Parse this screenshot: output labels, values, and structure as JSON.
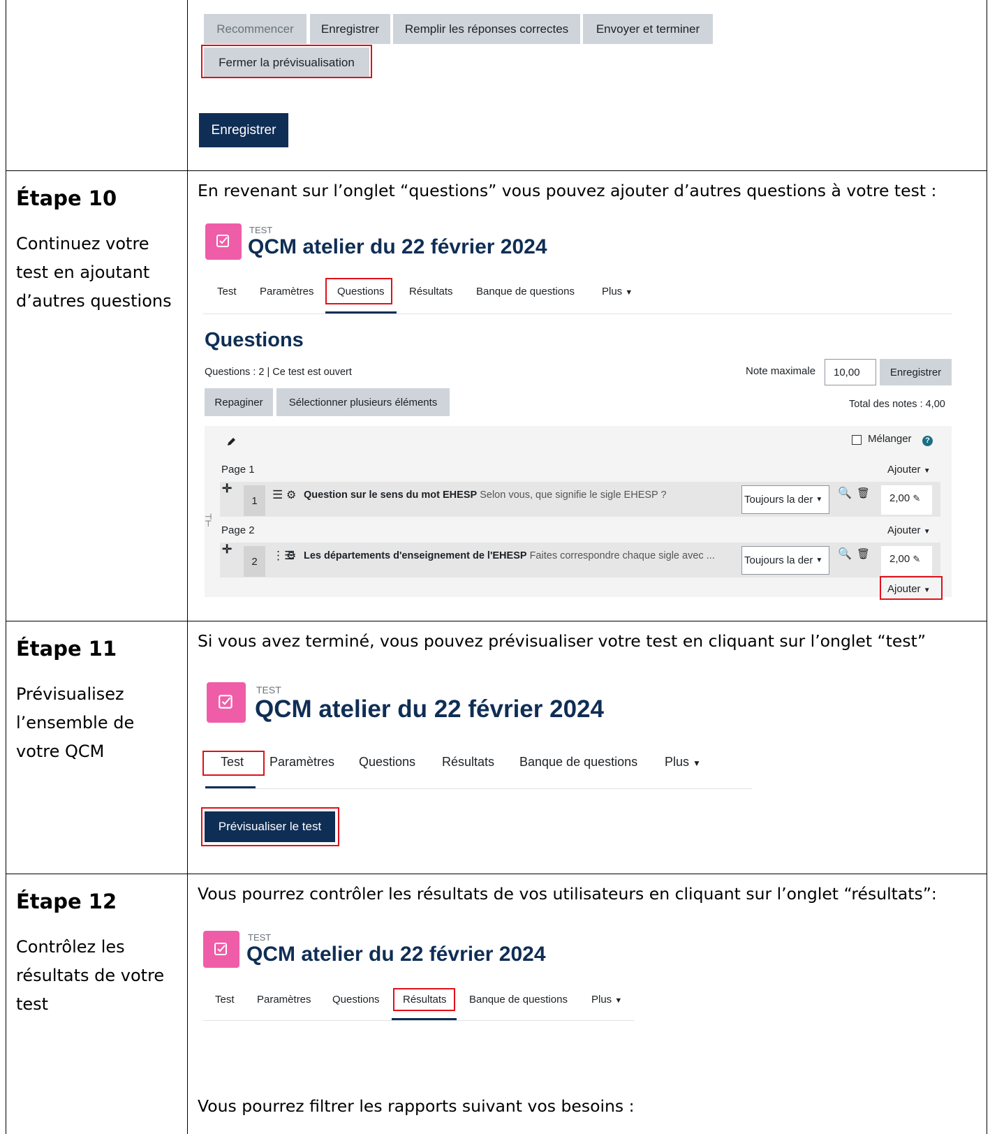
{
  "row1": {
    "buttons": {
      "recommencer": "Recommencer",
      "enregistrer": "Enregistrer",
      "remplir": "Remplir les réponses correctes",
      "envoyer": "Envoyer et terminer",
      "fermer": "Fermer la prévisualisation"
    },
    "save_button": "Enregistrer"
  },
  "step10": {
    "title": "Étape 10",
    "desc": "Continuez votre test en ajoutant d’autres questions",
    "intro": "En revenant sur l’onglet “questions” vous pouvez ajouter d’autres questions à votre test :",
    "test_label": "TEST",
    "quiz_title": "QCM atelier du 22 février 2024",
    "tabs": [
      "Test",
      "Paramètres",
      "Questions",
      "Résultats",
      "Banque de questions",
      "Plus"
    ],
    "heading": "Questions",
    "info": "Questions : 2 | Ce test est ouvert",
    "max_grade_label": "Note maximale",
    "max_grade_value": "10,00",
    "save": "Enregistrer",
    "repaginate": "Repaginer",
    "select_multiple": "Sélectionner plusieurs éléments",
    "total": "Total des notes : 4,00",
    "shuffle": "Mélanger",
    "add": "Ajouter",
    "pages": [
      {
        "label": "Page 1",
        "num": "1",
        "name": "Question sur le sens du mot EHESP",
        "text": "Selon vous, que signifie le sigle EHESP ?",
        "select": "Toujours la der",
        "mark": "2,00"
      },
      {
        "label": "Page 2",
        "num": "2",
        "name": "Les départements d'enseignement de l'EHESP",
        "text": "Faites correspondre chaque sigle avec ...",
        "select": "Toujours la der",
        "mark": "2,00"
      }
    ]
  },
  "step11": {
    "title": "Étape 11",
    "desc": "Prévisualisez l’ensemble de votre QCM",
    "intro": "Si vous avez terminé, vous pouvez prévisualiser votre test en cliquant sur l’onglet “test”",
    "test_label": "TEST",
    "quiz_title": "QCM atelier du 22 février 2024",
    "tabs": [
      "Test",
      "Paramètres",
      "Questions",
      "Résultats",
      "Banque de questions",
      "Plus"
    ],
    "preview_button": "Prévisualiser le test"
  },
  "step12": {
    "title": "Étape 12",
    "desc": "Contrôlez les résultats de votre test",
    "intro": "Vous pourrez contrôler les résultats de vos utilisateurs en cliquant sur l’onglet “résultats”:",
    "test_label": "TEST",
    "quiz_title": "QCM atelier du 22 février 2024",
    "tabs": [
      "Test",
      "Paramètres",
      "Questions",
      "Résultats",
      "Banque de questions",
      "Plus"
    ],
    "filter_text": "Vous pourrez filtrer les rapports suivant vos besoins :"
  },
  "colors": {
    "primary": "#0f2e55",
    "highlight": "#e0101a",
    "quiz_icon": "#ef5da8",
    "button_gray": "#ced4da"
  }
}
